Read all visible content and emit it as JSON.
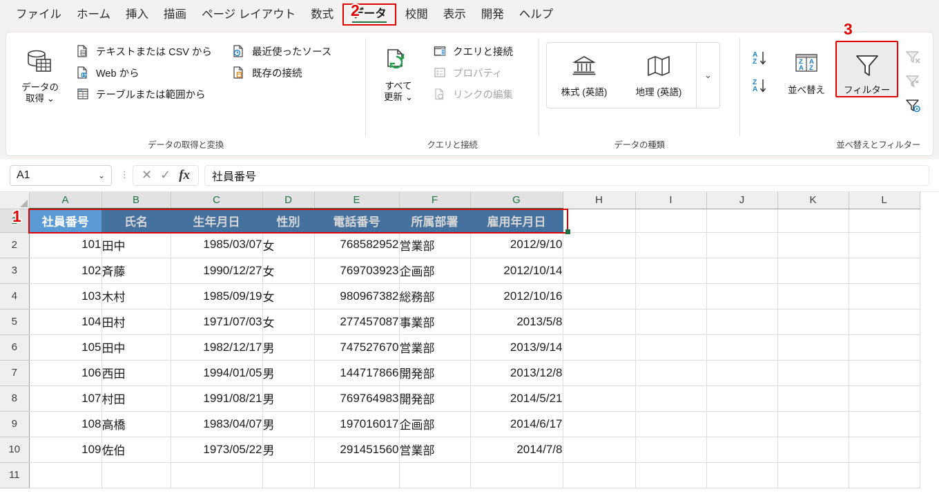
{
  "app": {
    "tabs": [
      {
        "label": "ファイル",
        "active": false
      },
      {
        "label": "ホーム",
        "active": false
      },
      {
        "label": "挿入",
        "active": false
      },
      {
        "label": "描画",
        "active": false
      },
      {
        "label": "ページ レイアウト",
        "active": false
      },
      {
        "label": "数式",
        "active": false
      },
      {
        "label": "データ",
        "active": true
      },
      {
        "label": "校閲",
        "active": false
      },
      {
        "label": "表示",
        "active": false
      },
      {
        "label": "開発",
        "active": false
      },
      {
        "label": "ヘルプ",
        "active": false
      }
    ]
  },
  "annotations": [
    {
      "id": "1",
      "text": "1"
    },
    {
      "id": "2",
      "text": "2"
    },
    {
      "id": "3",
      "text": "3"
    }
  ],
  "ribbon": {
    "groups": [
      {
        "name": "データの取得と変換",
        "big_button": {
          "label_line1": "データの",
          "label_line2": "取得 ⌄",
          "icon": "get-data-icon"
        },
        "items": [
          {
            "label": "テキストまたは CSV から",
            "icon": "csv-file-icon",
            "disabled": false
          },
          {
            "label": "Web から",
            "icon": "web-globe-icon",
            "disabled": false
          },
          {
            "label": "テーブルまたは範囲から",
            "icon": "table-range-icon",
            "disabled": false
          },
          {
            "label": "最近使ったソース",
            "icon": "recent-source-icon",
            "disabled": false
          },
          {
            "label": "既存の接続",
            "icon": "existing-connection-icon",
            "disabled": false
          }
        ]
      },
      {
        "name": "クエリと接続",
        "big_button": {
          "label_line1": "すべて",
          "label_line2": "更新 ⌄",
          "icon": "refresh-all-icon"
        },
        "items": [
          {
            "label": "クエリと接続",
            "icon": "queries-connections-icon",
            "disabled": false
          },
          {
            "label": "プロパティ",
            "icon": "properties-icon",
            "disabled": true
          },
          {
            "label": "リンクの編集",
            "icon": "edit-links-icon",
            "disabled": true
          }
        ]
      },
      {
        "name": "データの種類",
        "gallery": [
          {
            "label": "株式 (英語)",
            "icon": "stocks-bank-icon"
          },
          {
            "label": "地理 (英語)",
            "icon": "geography-map-icon"
          }
        ],
        "more_label": "⌄"
      },
      {
        "name": "並べ替えとフィルター",
        "sort_asc_label": "A↓",
        "sort_desc_label": "Z↓",
        "sort_button_label": "並べ替え",
        "filter_button_label": "フィルター",
        "extra_items": [
          {
            "icon": "clear-filter-icon"
          },
          {
            "icon": "reapply-filter-icon"
          },
          {
            "icon": "advanced-filter-icon"
          }
        ]
      }
    ]
  },
  "formula_bar": {
    "name_box_value": "A1",
    "cancel_icon": "✕",
    "confirm_icon": "✓",
    "fx_label": "fx",
    "content": "社員番号"
  },
  "sheet": {
    "column_headers": [
      "A",
      "B",
      "C",
      "D",
      "E",
      "F",
      "G",
      "H",
      "I",
      "J",
      "K",
      "L"
    ],
    "selected_columns": [
      "A",
      "B",
      "C",
      "D",
      "E",
      "F",
      "G"
    ],
    "row_numbers": [
      "1",
      "2",
      "3",
      "4",
      "5",
      "6",
      "7",
      "8",
      "9",
      "10",
      "11"
    ],
    "selected_rows": [
      "1"
    ],
    "active_cell": "A1",
    "header_row": [
      "社員番号",
      "氏名",
      "生年月日",
      "性別",
      "電話番号",
      "所属部署",
      "雇用年月日"
    ],
    "rows": [
      [
        "101",
        "田中",
        "1985/03/07",
        "女",
        "768582952",
        "営業部",
        "2012/9/10"
      ],
      [
        "102",
        "斉藤",
        "1990/12/27",
        "女",
        "769703923",
        "企画部",
        "2012/10/14"
      ],
      [
        "103",
        "木村",
        "1985/09/19",
        "女",
        "980967382",
        "総務部",
        "2012/10/16"
      ],
      [
        "104",
        "田村",
        "1971/07/03",
        "女",
        "277457087",
        "事業部",
        "2013/5/8"
      ],
      [
        "105",
        "田中",
        "1982/12/17",
        "男",
        "747527670",
        "営業部",
        "2013/9/14"
      ],
      [
        "106",
        "西田",
        "1994/01/05",
        "男",
        "144717866",
        "開発部",
        "2013/12/8"
      ],
      [
        "107",
        "村田",
        "1991/08/21",
        "男",
        "769764983",
        "開発部",
        "2014/5/21"
      ],
      [
        "108",
        "高橋",
        "1983/04/07",
        "男",
        "197016017",
        "企画部",
        "2014/6/17"
      ],
      [
        "109",
        "佐伯",
        "1973/05/22",
        "男",
        "291451560",
        "営業部",
        "2014/7/8"
      ]
    ],
    "column_alignments": [
      "num",
      "txt",
      "num",
      "txt",
      "num",
      "txt",
      "num"
    ]
  },
  "colors": {
    "header_fill": "#44719E",
    "active_cell_fill": "#5B9BD5",
    "annotation_red": "#E00000",
    "excel_green": "#217346",
    "ribbon_bg": "#F3F2F1"
  }
}
